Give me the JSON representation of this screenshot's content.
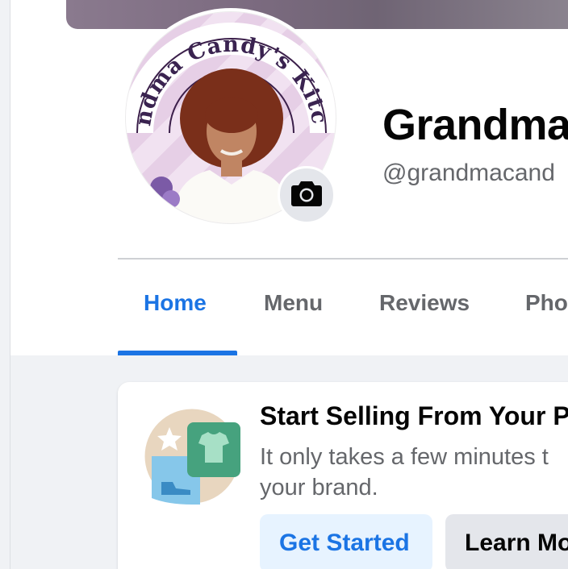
{
  "profile": {
    "name": "Grandma",
    "handle": "@grandmacand",
    "logo_text": "Grandma Candy's Kitchen",
    "camera_icon": "camera-icon"
  },
  "tabs": [
    {
      "label": "Home",
      "active": true
    },
    {
      "label": "Menu",
      "active": false
    },
    {
      "label": "Reviews",
      "active": false
    },
    {
      "label": "Pho",
      "active": false
    }
  ],
  "promo_card": {
    "title": "Start Selling From Your P",
    "body_lines": [
      "It only takes a few minutes t",
      "your brand."
    ],
    "primary_button": "Get Started",
    "secondary_button": "Learn Mo",
    "icon": "shop-icon"
  },
  "colors": {
    "accent": "#1b74e4",
    "primary_button_bg": "#e7f3ff",
    "secondary_button_bg": "#e4e6eb",
    "feed_bg": "#f0f2f5"
  }
}
